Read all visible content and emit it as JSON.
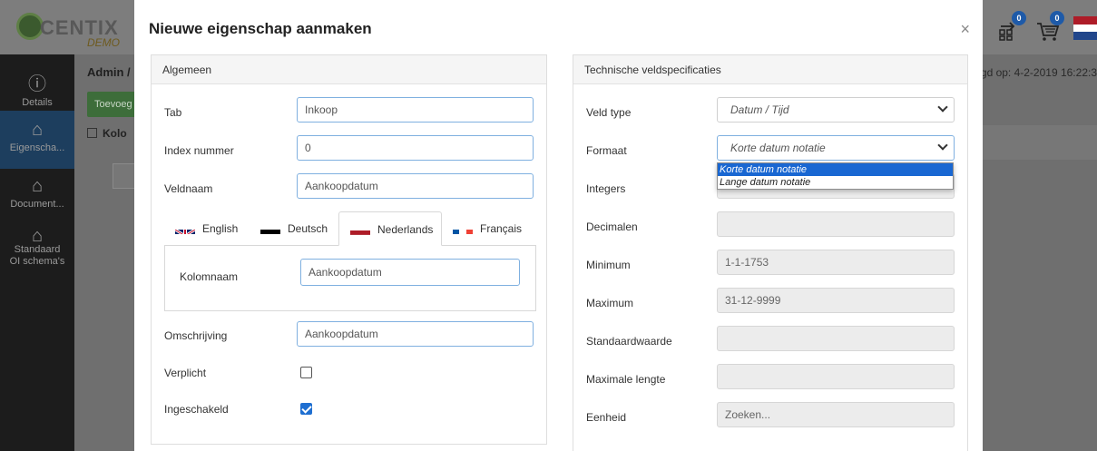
{
  "background": {
    "logo_text": "CENTIX",
    "logo_sub": "DEMO",
    "paren": ")",
    "badge1": "0",
    "badge2": "0",
    "breadcrumb": "Admin /",
    "updated": "gd op: 4-2-2019 16:22:3",
    "add_button": "Toevoeg",
    "col_label": "Kolo",
    "sidebar": [
      {
        "label": "Details",
        "icon": "info-icon"
      },
      {
        "label": "Eigenscha...",
        "icon": "tag-icon"
      },
      {
        "label": "Document...",
        "icon": "tag-icon"
      },
      {
        "label": "Standaard OI schema's",
        "icon": "tag-icon"
      }
    ]
  },
  "modal": {
    "title": "Nieuwe eigenschap aanmaken",
    "close": "×",
    "left_panel": {
      "heading": "Algemeen",
      "tab_label": "Tab",
      "tab_value": "Inkoop",
      "index_label": "Index nummer",
      "index_value": "0",
      "veldnaam_label": "Veldnaam",
      "veldnaam_value": "Aankoopdatum",
      "languages": [
        {
          "label": "English",
          "flag": "uk-flag-icon"
        },
        {
          "label": "Deutsch",
          "flag": "de-flag-icon"
        },
        {
          "label": "Nederlands",
          "flag": "nl-flag-icon"
        },
        {
          "label": "Français",
          "flag": "fr-flag-icon"
        }
      ],
      "active_language": "Nederlands",
      "kolomnaam_label": "Kolomnaam",
      "kolomnaam_value": "Aankoopdatum",
      "omschrijving_label": "Omschrijving",
      "omschrijving_value": "Aankoopdatum",
      "verplicht_label": "Verplicht",
      "verplicht_checked": false,
      "ingeschakeld_label": "Ingeschakeld",
      "ingeschakeld_checked": true
    },
    "right_panel": {
      "heading": "Technische veldspecificaties",
      "veldtype_label": "Veld type",
      "veldtype_value": "Datum / Tijd",
      "formaat_label": "Formaat",
      "formaat_value": "Korte datum notatie",
      "formaat_options": [
        "Korte datum notatie",
        "Lange datum notatie"
      ],
      "integers_label": "Integers",
      "decimalen_label": "Decimalen",
      "minimum_label": "Minimum",
      "minimum_value": "1-1-1753",
      "maximum_label": "Maximum",
      "maximum_value": "31-12-9999",
      "standaard_label": "Standaardwaarde",
      "maxlengte_label": "Maximale lengte",
      "eenheid_label": "Eenheid",
      "eenheid_placeholder": "Zoeken..."
    }
  },
  "colors": {
    "accent": "#1967d2",
    "focus_border": "#7fb0e0",
    "sidebar_bg": "#1c1c1c"
  }
}
